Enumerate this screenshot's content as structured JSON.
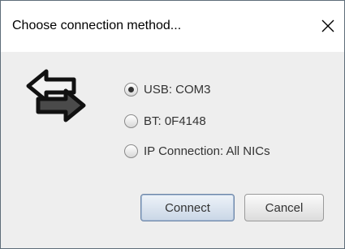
{
  "window": {
    "title": "Choose connection method...",
    "close_icon": "close-icon"
  },
  "content": {
    "icon": "swap-arrows-icon",
    "options": [
      {
        "label": "USB: COM3",
        "selected": true
      },
      {
        "label": "BT: 0F4148",
        "selected": false
      },
      {
        "label": "IP Connection: All NICs",
        "selected": false
      }
    ]
  },
  "buttons": {
    "connect_label": "Connect",
    "cancel_label": "Cancel"
  },
  "colors": {
    "client_background": "#eeeeee",
    "connect_button": "#c9d6e6",
    "text": "#333333"
  }
}
